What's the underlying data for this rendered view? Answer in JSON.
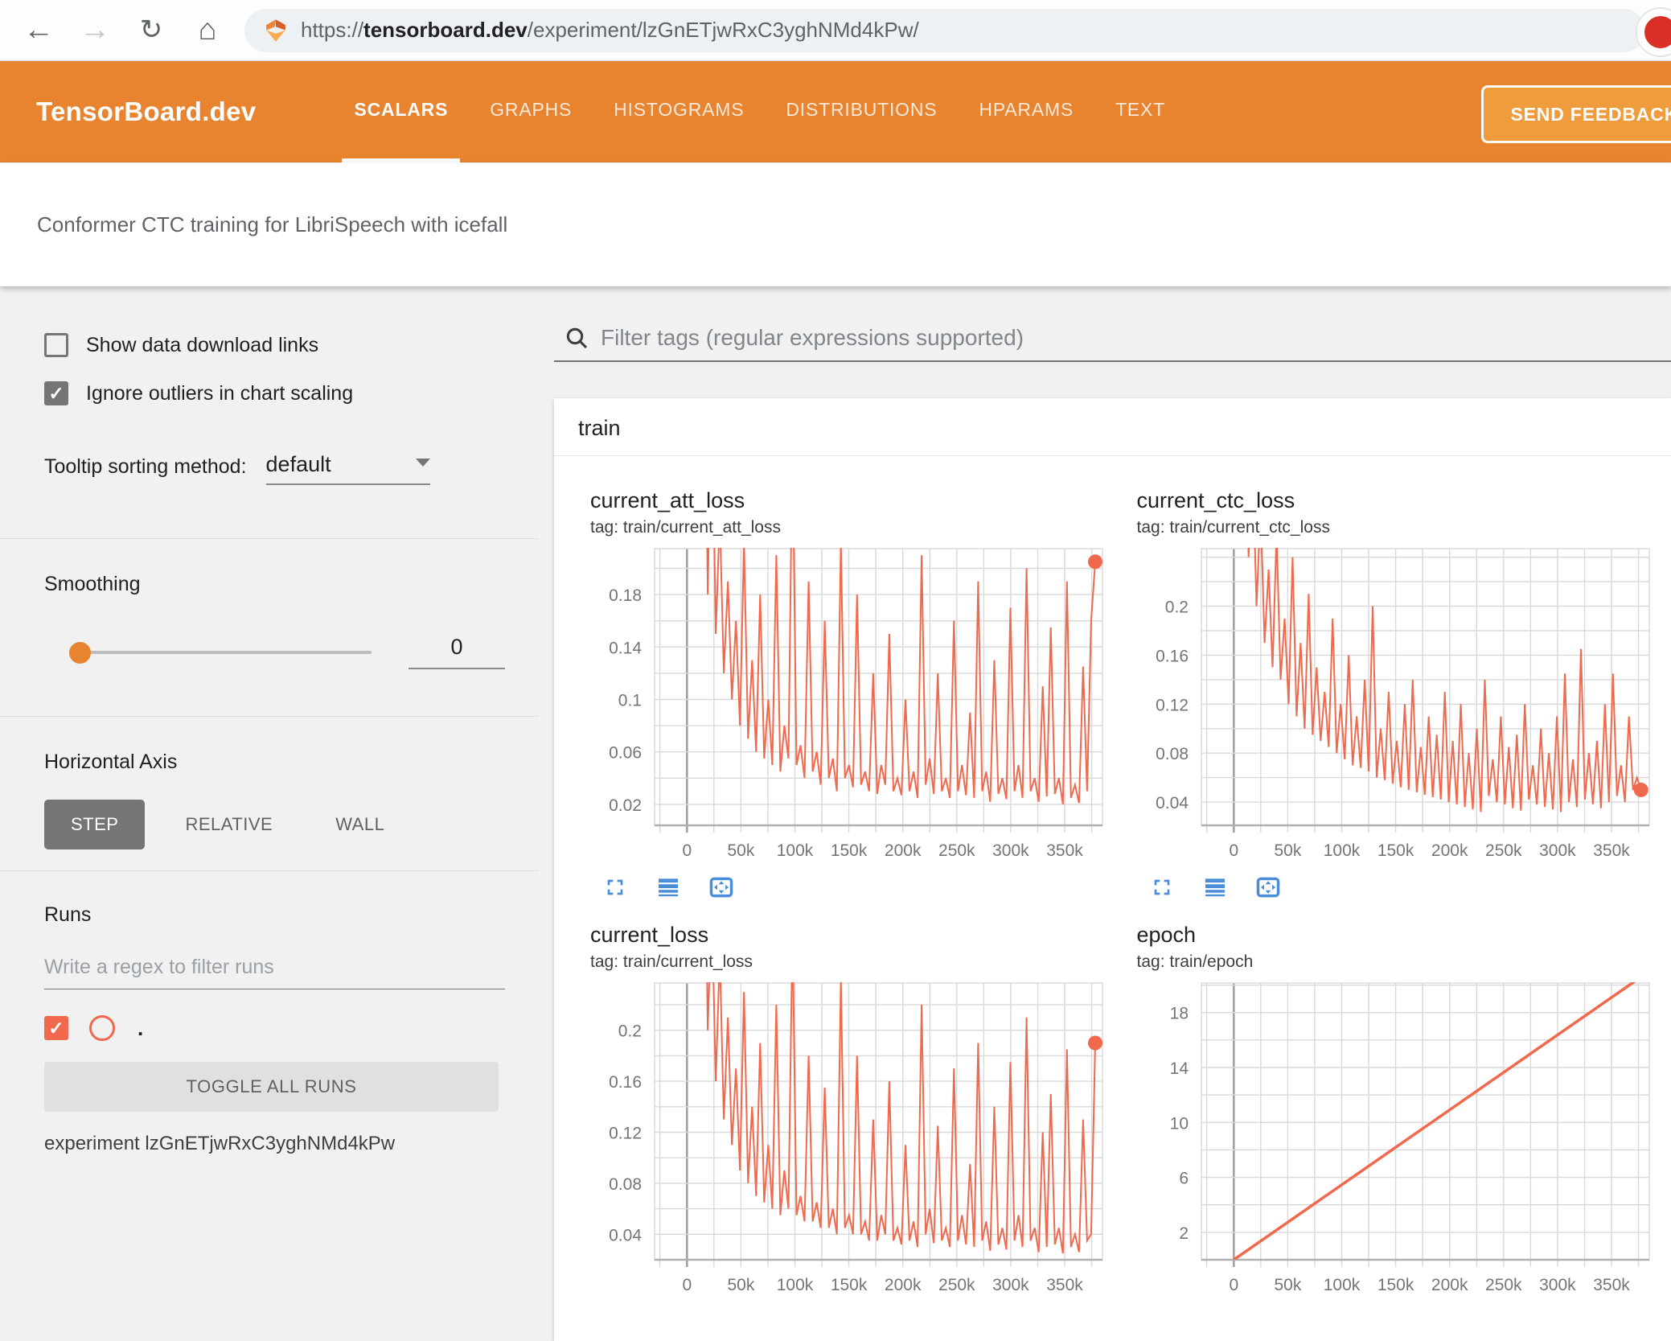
{
  "browser": {
    "url_scheme": "https://",
    "url_domain": "tensorboard.dev",
    "url_path": "/experiment/lzGnETjwRxC3yghNMd4kPw/"
  },
  "header": {
    "logo": "TensorBoard.dev",
    "tabs": [
      {
        "label": "SCALARS",
        "active": true
      },
      {
        "label": "GRAPHS",
        "active": false
      },
      {
        "label": "HISTOGRAMS",
        "active": false
      },
      {
        "label": "DISTRIBUTIONS",
        "active": false
      },
      {
        "label": "HPARAMS",
        "active": false
      },
      {
        "label": "TEXT",
        "active": false
      }
    ],
    "feedback_label": "SEND FEEDBACK"
  },
  "experiment_bar": {
    "title": "Conformer CTC training for LibriSpeech with icefall"
  },
  "sidebar": {
    "checkboxes": [
      {
        "label": "Show data download links",
        "checked": false
      },
      {
        "label": "Ignore outliers in chart scaling",
        "checked": true
      }
    ],
    "tooltip_sorting": {
      "label": "Tooltip sorting method:",
      "value": "default"
    },
    "smoothing": {
      "label": "Smoothing",
      "value": "0"
    },
    "horizontal_axis": {
      "label": "Horizontal Axis",
      "options": [
        {
          "label": "STEP",
          "active": true
        },
        {
          "label": "RELATIVE",
          "active": false
        },
        {
          "label": "WALL",
          "active": false
        }
      ]
    },
    "runs": {
      "label": "Runs",
      "filter_placeholder": "Write a regex to filter runs",
      "run_name": ".",
      "run_checked": true,
      "toggle_all_label": "TOGGLE ALL RUNS",
      "experiment_label": "experiment lzGnETjwRxC3yghNMd4kPw"
    }
  },
  "main": {
    "filter_placeholder": "Filter tags (regular expressions supported)",
    "group_title": "train"
  },
  "colors": {
    "header_orange": "#e8842f",
    "feedback_button_orange": "#f09c3c",
    "run_color": "#f0694d",
    "icon_blue": "#4a8eda"
  },
  "chart_data": [
    {
      "type": "line",
      "title": "current_att_loss",
      "tag": "tag: train/current_att_loss",
      "xlim": [
        -30000,
        385000
      ],
      "x_grid_step": 25000,
      "x_tick_values": [
        0,
        50000,
        100000,
        150000,
        200000,
        250000,
        300000,
        350000
      ],
      "x_tick_labels": [
        "0",
        "50k",
        "100k",
        "150k",
        "200k",
        "250k",
        "300k",
        "350k"
      ],
      "ylim": [
        0.004,
        0.215
      ],
      "y_grid_step": 0.02,
      "y_tick_values": [
        0.02,
        0.06,
        0.1,
        0.14,
        0.18
      ],
      "y_tick_labels": [
        "0.02",
        "0.06",
        "0.1",
        "0.14",
        "0.18"
      ],
      "grid": true,
      "legend": "none",
      "series": [
        {
          "name": ".",
          "color": "#f0694d",
          "stroke": 2,
          "end_marker": true,
          "x_start": 8000,
          "x_step": 3740,
          "values": [
            0.3,
            0.22,
            0.5,
            0.18,
            0.35,
            0.15,
            0.24,
            0.12,
            0.19,
            0.1,
            0.16,
            0.08,
            0.22,
            0.07,
            0.13,
            0.06,
            0.18,
            0.055,
            0.1,
            0.05,
            0.21,
            0.045,
            0.08,
            0.055,
            0.3,
            0.05,
            0.065,
            0.04,
            0.19,
            0.045,
            0.06,
            0.035,
            0.16,
            0.04,
            0.055,
            0.03,
            0.22,
            0.04,
            0.05,
            0.033,
            0.18,
            0.035,
            0.045,
            0.03,
            0.12,
            0.028,
            0.05,
            0.035,
            0.15,
            0.03,
            0.04,
            0.027,
            0.1,
            0.03,
            0.045,
            0.025,
            0.21,
            0.035,
            0.055,
            0.028,
            0.12,
            0.03,
            0.04,
            0.025,
            0.16,
            0.03,
            0.05,
            0.027,
            0.09,
            0.025,
            0.19,
            0.03,
            0.045,
            0.022,
            0.13,
            0.028,
            0.04,
            0.024,
            0.17,
            0.03,
            0.05,
            0.025,
            0.2,
            0.03,
            0.04,
            0.022,
            0.11,
            0.026,
            0.155,
            0.028,
            0.04,
            0.02,
            0.19,
            0.025,
            0.035,
            0.021,
            0.125,
            0.03,
            0.16,
            0.205
          ]
        }
      ],
      "has_toolbar": true
    },
    {
      "type": "line",
      "title": "current_ctc_loss",
      "tag": "tag: train/current_ctc_loss",
      "xlim": [
        -30000,
        385000
      ],
      "x_grid_step": 25000,
      "x_tick_values": [
        0,
        50000,
        100000,
        150000,
        200000,
        250000,
        300000,
        350000
      ],
      "x_tick_labels": [
        "0",
        "50k",
        "100k",
        "150k",
        "200k",
        "250k",
        "300k",
        "350k"
      ],
      "ylim": [
        0.021,
        0.247
      ],
      "y_grid_step": 0.02,
      "y_tick_values": [
        0.04,
        0.08,
        0.12,
        0.16,
        0.2
      ],
      "y_tick_labels": [
        "0.04",
        "0.08",
        "0.12",
        "0.16",
        "0.2"
      ],
      "grid": true,
      "legend": "none",
      "series": [
        {
          "name": ".",
          "color": "#f0694d",
          "stroke": 2,
          "end_marker": true,
          "x_start": 10000,
          "x_step": 3710,
          "values": [
            0.4,
            0.24,
            0.32,
            0.2,
            0.28,
            0.17,
            0.23,
            0.15,
            0.26,
            0.14,
            0.19,
            0.12,
            0.24,
            0.11,
            0.17,
            0.1,
            0.21,
            0.095,
            0.15,
            0.09,
            0.13,
            0.085,
            0.19,
            0.08,
            0.12,
            0.075,
            0.16,
            0.07,
            0.11,
            0.068,
            0.14,
            0.065,
            0.2,
            0.06,
            0.1,
            0.058,
            0.13,
            0.055,
            0.09,
            0.052,
            0.12,
            0.05,
            0.14,
            0.048,
            0.085,
            0.046,
            0.11,
            0.044,
            0.095,
            0.042,
            0.13,
            0.04,
            0.09,
            0.038,
            0.12,
            0.036,
            0.08,
            0.034,
            0.1,
            0.032,
            0.14,
            0.045,
            0.075,
            0.04,
            0.11,
            0.038,
            0.085,
            0.035,
            0.095,
            0.033,
            0.12,
            0.042,
            0.07,
            0.038,
            0.1,
            0.036,
            0.08,
            0.034,
            0.11,
            0.032,
            0.145,
            0.04,
            0.075,
            0.036,
            0.165,
            0.042,
            0.08,
            0.038,
            0.09,
            0.035,
            0.12,
            0.04,
            0.145,
            0.045,
            0.07,
            0.04,
            0.11,
            0.05,
            0.06,
            0.05
          ]
        }
      ],
      "has_toolbar": true
    },
    {
      "type": "line",
      "title": "current_loss",
      "tag": "tag: train/current_loss",
      "xlim": [
        -30000,
        385000
      ],
      "x_grid_step": 25000,
      "x_tick_values": [
        0,
        50000,
        100000,
        150000,
        200000,
        250000,
        300000,
        350000
      ],
      "x_tick_labels": [
        "0",
        "50k",
        "100k",
        "150k",
        "200k",
        "250k",
        "300k",
        "350k"
      ],
      "ylim": [
        0.02,
        0.237
      ],
      "y_grid_step": 0.02,
      "y_tick_values": [
        0.04,
        0.08,
        0.12,
        0.16,
        0.2
      ],
      "y_tick_labels": [
        "0.04",
        "0.08",
        "0.12",
        "0.16",
        "0.2"
      ],
      "grid": true,
      "legend": "none",
      "series": [
        {
          "name": ".",
          "color": "#f0694d",
          "stroke": 2,
          "end_marker": true,
          "x_start": 8000,
          "x_step": 3740,
          "values": [
            0.35,
            0.24,
            0.45,
            0.2,
            0.3,
            0.16,
            0.26,
            0.13,
            0.21,
            0.11,
            0.17,
            0.09,
            0.23,
            0.08,
            0.14,
            0.07,
            0.19,
            0.065,
            0.11,
            0.06,
            0.22,
            0.055,
            0.09,
            0.06,
            0.28,
            0.055,
            0.07,
            0.05,
            0.18,
            0.05,
            0.065,
            0.045,
            0.155,
            0.045,
            0.06,
            0.04,
            0.24,
            0.045,
            0.055,
            0.04,
            0.18,
            0.04,
            0.05,
            0.035,
            0.13,
            0.035,
            0.055,
            0.04,
            0.16,
            0.035,
            0.045,
            0.032,
            0.11,
            0.035,
            0.05,
            0.03,
            0.22,
            0.04,
            0.06,
            0.033,
            0.125,
            0.035,
            0.045,
            0.03,
            0.17,
            0.035,
            0.055,
            0.032,
            0.095,
            0.03,
            0.19,
            0.035,
            0.05,
            0.027,
            0.14,
            0.032,
            0.045,
            0.028,
            0.175,
            0.035,
            0.055,
            0.03,
            0.21,
            0.035,
            0.045,
            0.026,
            0.12,
            0.03,
            0.15,
            0.032,
            0.045,
            0.025,
            0.185,
            0.03,
            0.04,
            0.026,
            0.13,
            0.035,
            0.04,
            0.19
          ]
        }
      ],
      "has_toolbar": true
    },
    {
      "type": "line",
      "title": "epoch",
      "tag": "tag: train/epoch",
      "xlim": [
        -30000,
        385000
      ],
      "x_grid_step": 25000,
      "x_tick_values": [
        0,
        50000,
        100000,
        150000,
        200000,
        250000,
        300000,
        350000
      ],
      "x_tick_labels": [
        "0",
        "50k",
        "100k",
        "150k",
        "200k",
        "250k",
        "300k",
        "350k"
      ],
      "ylim": [
        0,
        20.15
      ],
      "y_grid_step": 2,
      "y_tick_values": [
        2,
        6,
        10,
        14,
        18
      ],
      "y_tick_labels": [
        "2",
        "6",
        "10",
        "14",
        "18"
      ],
      "grid": true,
      "legend": "none",
      "series": [
        {
          "name": ".",
          "color": "#f0694d",
          "stroke": 3.5,
          "end_marker": false,
          "x_start": 0,
          "x_step": 372000,
          "values": [
            0,
            20.3
          ]
        }
      ],
      "has_toolbar": false
    }
  ]
}
